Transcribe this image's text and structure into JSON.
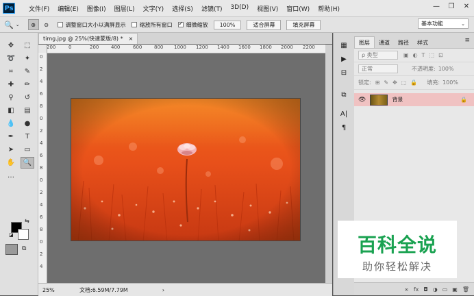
{
  "app": {
    "logo": "Ps"
  },
  "menu": [
    "文件(F)",
    "编辑(E)",
    "图像(I)",
    "图层(L)",
    "文字(Y)",
    "选择(S)",
    "滤镜(T)",
    "3D(D)",
    "视图(V)",
    "窗口(W)",
    "帮助(H)"
  ],
  "window_controls": {
    "minimize": "—",
    "restore": "❐",
    "close": "✕"
  },
  "options_bar": {
    "checkbox_resize": "调整窗口大小以满屏显示",
    "checkbox_all_windows": "缩放所有窗口",
    "checkbox_scrubby": "细微缩放",
    "zoom_value": "100%",
    "fit_screen": "适合屏幕",
    "fill_screen": "填充屏幕",
    "workspace": "基本功能"
  },
  "document": {
    "tab_title": "timg.jpg @ 25%(快速蒙版/8) *",
    "tab_close": "×"
  },
  "ruler": {
    "h_labels": [
      "200",
      "0",
      "200",
      "400",
      "600",
      "800",
      "1000",
      "1200",
      "1400",
      "1600",
      "1800",
      "2000",
      "2200"
    ],
    "v_labels": [
      "0",
      "2",
      "4",
      "6",
      "8",
      "0",
      "2",
      "4",
      "6",
      "8",
      "0",
      "2",
      "4",
      "6",
      "8",
      "0",
      "2",
      "4"
    ]
  },
  "status": {
    "zoom": "25%",
    "doc_info": "文档:6.59M/7.79M"
  },
  "panel": {
    "tabs": [
      "图层",
      "通道",
      "路径",
      "样式"
    ],
    "filter_kind": "ρ 类型",
    "blend_mode": "正常",
    "opacity_label": "不透明度:",
    "opacity_value": "100%",
    "lock_label": "锁定:",
    "fill_label": "填充:",
    "fill_value": "100%",
    "layer_name": "背景",
    "bottom_icons": [
      "∞",
      "fx",
      "◘",
      "◑",
      "▭",
      "▣",
      "🗑"
    ]
  },
  "watermark": {
    "title": "百科全说",
    "subtitle": "助你轻松解决"
  }
}
